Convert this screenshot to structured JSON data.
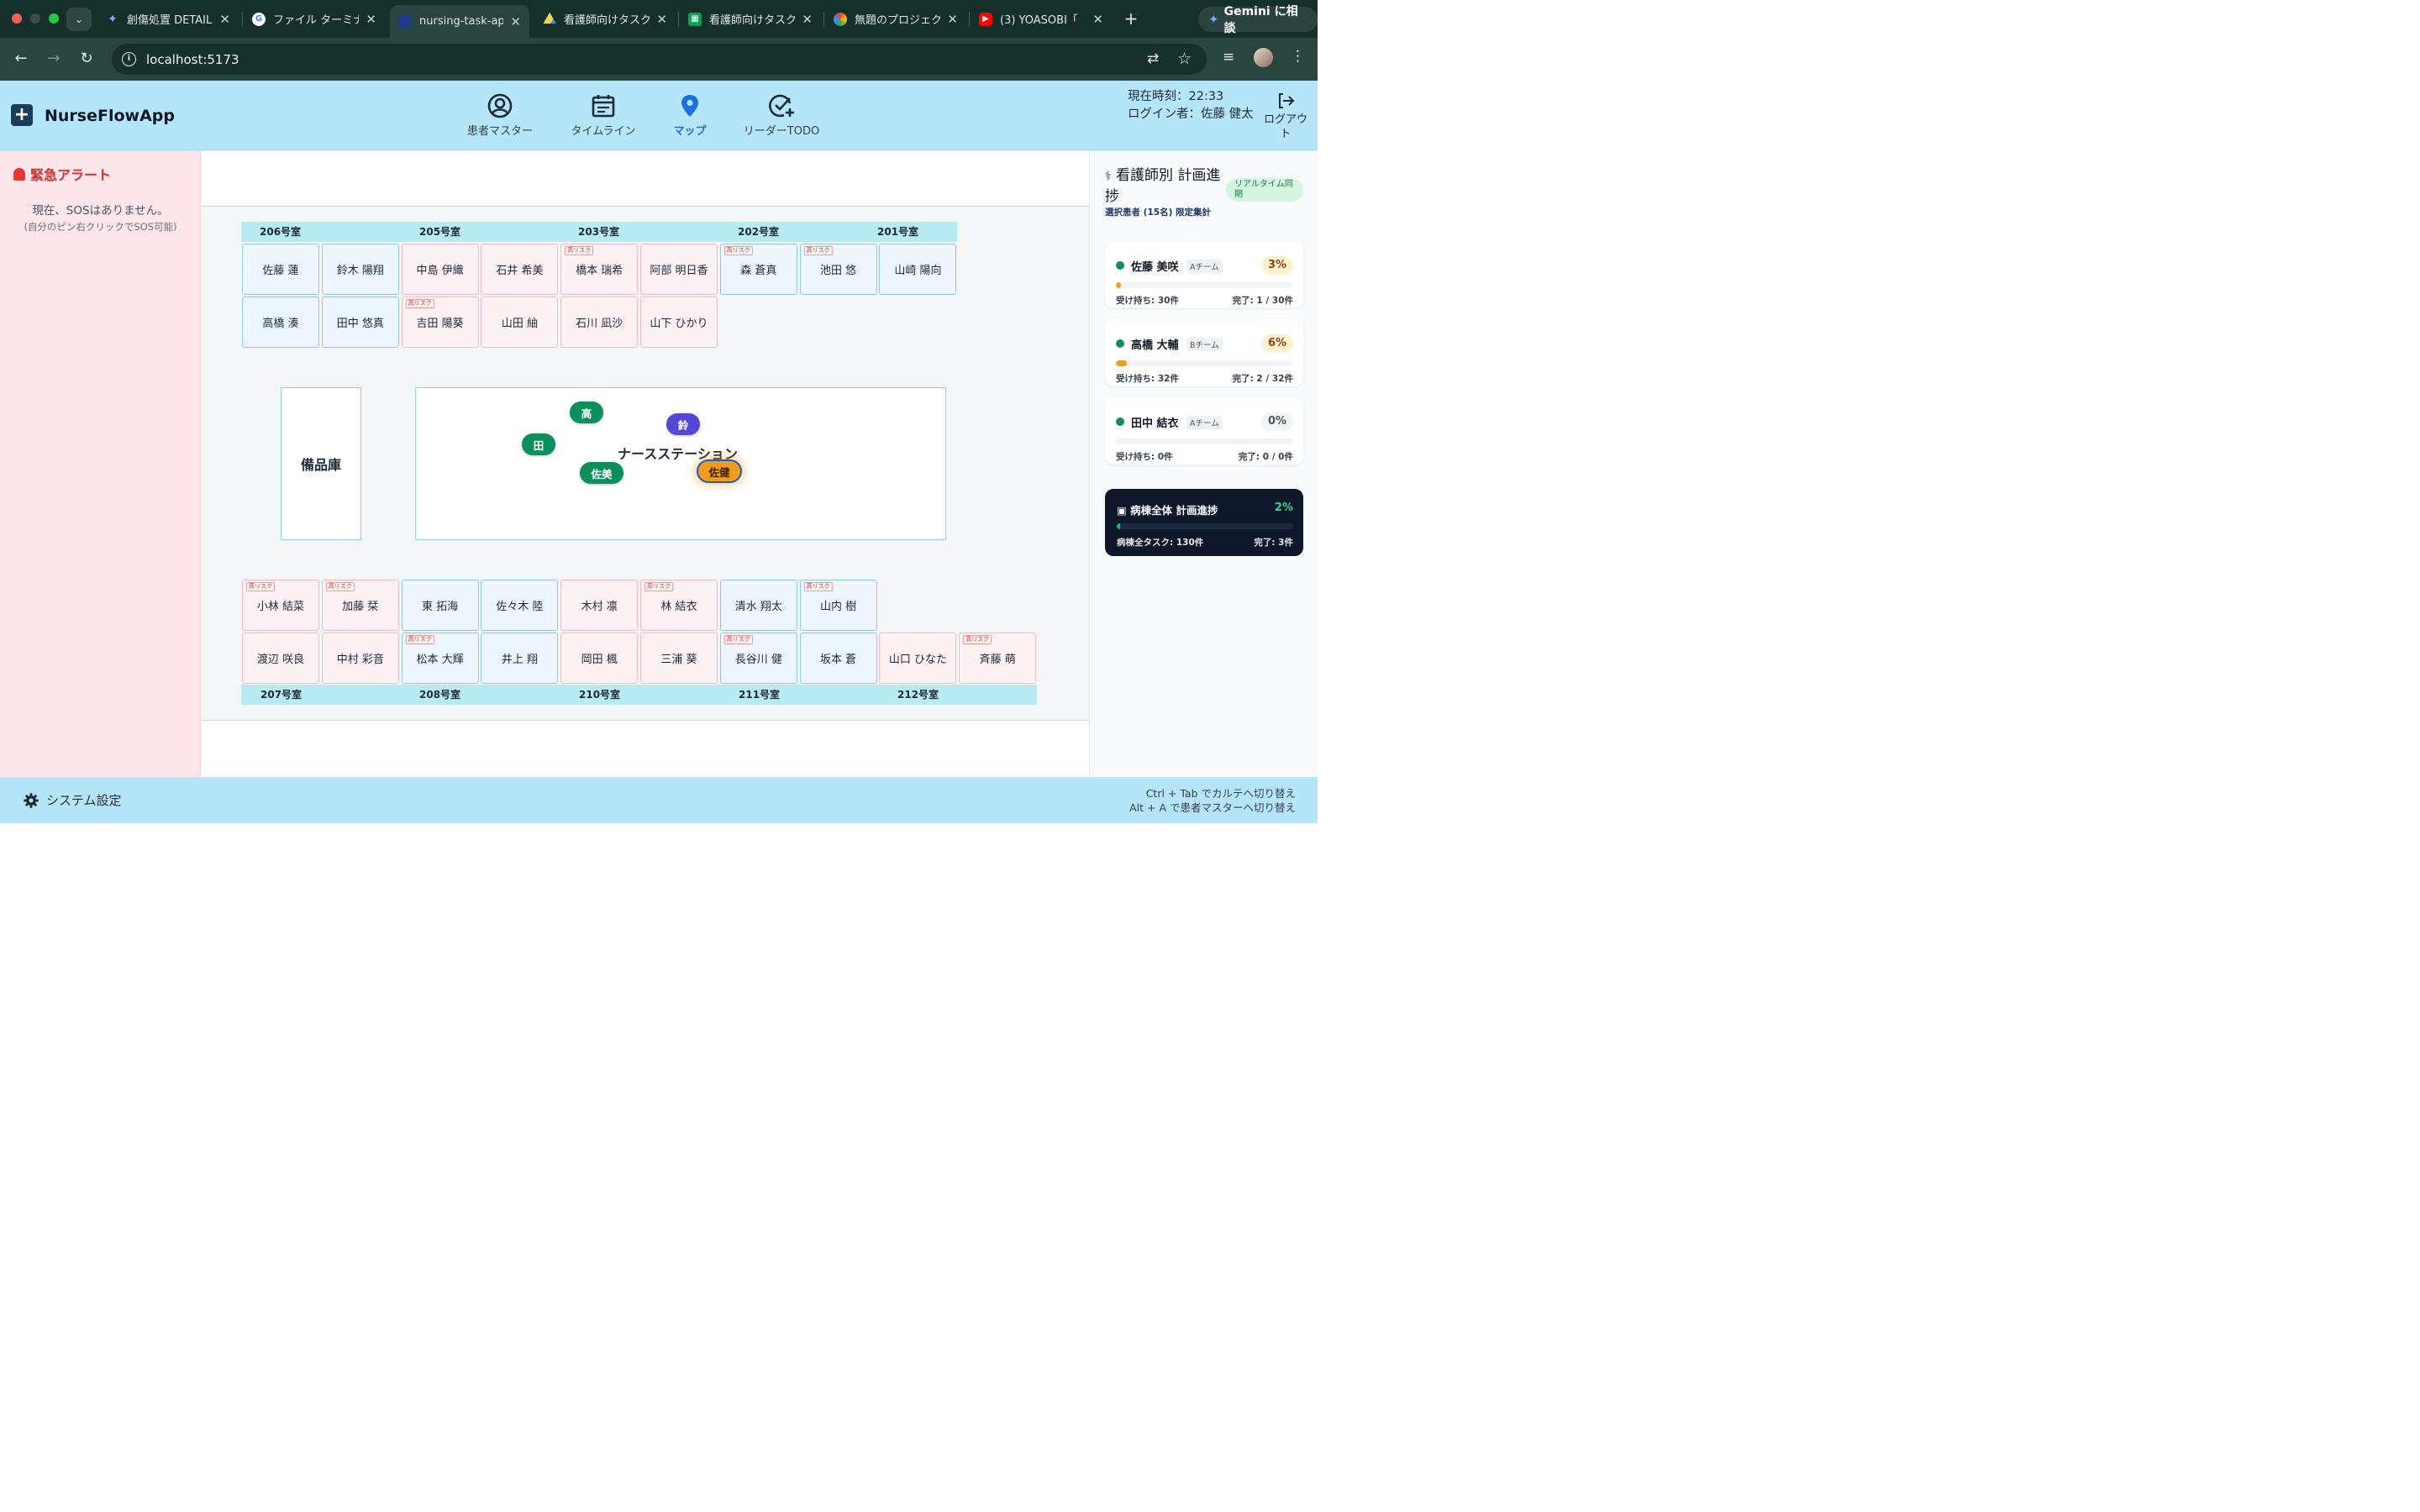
{
  "browser": {
    "tabs": [
      {
        "title": "創傷処置 DETAIL",
        "icon": "gemini-spark-icon",
        "active": false
      },
      {
        "title": "ファイル ターミナ",
        "icon": "google-g-icon",
        "active": false
      },
      {
        "title": "nursing-task-ap",
        "icon": "app-icon",
        "active": true
      },
      {
        "title": "看護師向けタスク",
        "icon": "drive-icon",
        "active": false
      },
      {
        "title": "看護師向けタスク",
        "icon": "sheets-icon",
        "active": false
      },
      {
        "title": "無題のプロジェク",
        "icon": "colorful-icon",
        "active": false
      },
      {
        "title": "(3) YOASOBI「",
        "icon": "youtube-icon",
        "active": false
      }
    ],
    "gemini_label": "Gemini に相談",
    "url": "localhost:5173"
  },
  "header": {
    "app_title": "NurseFlowApp",
    "nav": [
      {
        "label": "患者マスター",
        "icon": "user-circle-icon",
        "active": false
      },
      {
        "label": "タイムライン",
        "icon": "calendar-icon",
        "active": false
      },
      {
        "label": "マップ",
        "icon": "map-pin-icon",
        "active": true
      },
      {
        "label": "リーダーTODO",
        "icon": "check-plus-icon",
        "active": false
      }
    ],
    "clock": "現在時刻：22:33",
    "login": "ログイン者：佐藤 健太",
    "logout": "ログアウト"
  },
  "alerts": {
    "title": "緊急アラート",
    "message": "現在、SOSはありません。",
    "sub": "(自分のピン右クリックでSOS可能)"
  },
  "map": {
    "top_rooms": [
      "206号室",
      "205号室",
      "203号室",
      "202号室",
      "201号室"
    ],
    "bottom_rooms": [
      "207号室",
      "208号室",
      "210号室",
      "211号室",
      "212号室"
    ],
    "risk_label": "高リスク",
    "top_row1": [
      {
        "name": "佐藤 蓮",
        "risk": false,
        "type": "normal"
      },
      {
        "name": "鈴木 陽翔",
        "risk": false,
        "type": "normal"
      },
      {
        "name": "中島 伊織",
        "risk": false,
        "type": "risk"
      },
      {
        "name": "石井 希美",
        "risk": false,
        "type": "risk"
      },
      {
        "name": "橋本 瑞希",
        "risk": true,
        "type": "risk"
      },
      {
        "name": "阿部 明日香",
        "risk": false,
        "type": "risk"
      },
      {
        "name": "森 蒼真",
        "risk": true,
        "type": "normal"
      },
      {
        "name": "池田 悠",
        "risk": true,
        "type": "normal"
      },
      {
        "name": "山崎 陽向",
        "risk": false,
        "type": "normal"
      }
    ],
    "top_row2": [
      {
        "name": "高橋 湊",
        "risk": false,
        "type": "normal"
      },
      {
        "name": "田中 悠真",
        "risk": false,
        "type": "normal"
      },
      {
        "name": "吉田 陽葵",
        "risk": true,
        "type": "risk"
      },
      {
        "name": "山田 紬",
        "risk": false,
        "type": "risk"
      },
      {
        "name": "石川 凪沙",
        "risk": false,
        "type": "risk"
      },
      {
        "name": "山下 ひかり",
        "risk": false,
        "type": "risk"
      }
    ],
    "bottom_row1": [
      {
        "name": "小林 結菜",
        "risk": true,
        "type": "risk"
      },
      {
        "name": "加藤 栞",
        "risk": true,
        "type": "risk"
      },
      {
        "name": "東 拓海",
        "risk": false,
        "type": "normal"
      },
      {
        "name": "佐々木 陸",
        "risk": false,
        "type": "normal"
      },
      {
        "name": "木村 凛",
        "risk": false,
        "type": "risk"
      },
      {
        "name": "林 結衣",
        "risk": true,
        "type": "risk"
      },
      {
        "name": "清水 翔太",
        "risk": false,
        "type": "normal"
      },
      {
        "name": "山内 樹",
        "risk": true,
        "type": "normal"
      }
    ],
    "bottom_row2": [
      {
        "name": "渡辺 咲良",
        "risk": false,
        "type": "risk"
      },
      {
        "name": "中村 彩音",
        "risk": false,
        "type": "risk"
      },
      {
        "name": "松本 大輝",
        "risk": true,
        "type": "normal"
      },
      {
        "name": "井上 翔",
        "risk": false,
        "type": "normal"
      },
      {
        "name": "岡田 楓",
        "risk": false,
        "type": "risk"
      },
      {
        "name": "三浦 葵",
        "risk": false,
        "type": "risk"
      },
      {
        "name": "長谷川 健",
        "risk": true,
        "type": "normal"
      },
      {
        "name": "坂本 蒼",
        "risk": false,
        "type": "normal"
      },
      {
        "name": "山口 ひなた",
        "risk": false,
        "type": "risk"
      },
      {
        "name": "斉藤 萌",
        "risk": true,
        "type": "risk"
      }
    ],
    "storage": "備品庫",
    "station": "ナースステーション",
    "pins": [
      {
        "label": "高",
        "color": "green"
      },
      {
        "label": "鈴",
        "color": "purple"
      },
      {
        "label": "田",
        "color": "green"
      },
      {
        "label": "佐美",
        "color": "green"
      },
      {
        "label": "佐健",
        "color": "orange"
      }
    ]
  },
  "progress": {
    "title": "看護師別 計画進捗",
    "badge": "リアルタイム同期",
    "sub": "選択患者 (15名) 限定集計",
    "nurses": [
      {
        "name": "佐藤 美咲",
        "team": "Aチーム",
        "percent": "3%",
        "ratio": 0.03,
        "assigned": "受け持ち: 30件",
        "done": "完了: 1 / 30件"
      },
      {
        "name": "高橋 大輔",
        "team": "Bチーム",
        "percent": "6%",
        "ratio": 0.06,
        "assigned": "受け持ち: 32件",
        "done": "完了: 2 / 32件"
      },
      {
        "name": "田中 結衣",
        "team": "Aチーム",
        "percent": "0%",
        "ratio": 0.0,
        "assigned": "受け持ち: 0件",
        "done": "完了: 0 / 0件"
      }
    ],
    "ward": {
      "title": "病棟全体 計画進捗",
      "percent": "2%",
      "ratio": 0.02,
      "total": "病棟全タスク: 130件",
      "done": "完了: 3件"
    }
  },
  "footer": {
    "settings": "システム設定",
    "shortcut1": "Ctrl + Tab でカルテへ切り替え",
    "shortcut2": "Alt + A で患者マスターへ切り替え"
  }
}
